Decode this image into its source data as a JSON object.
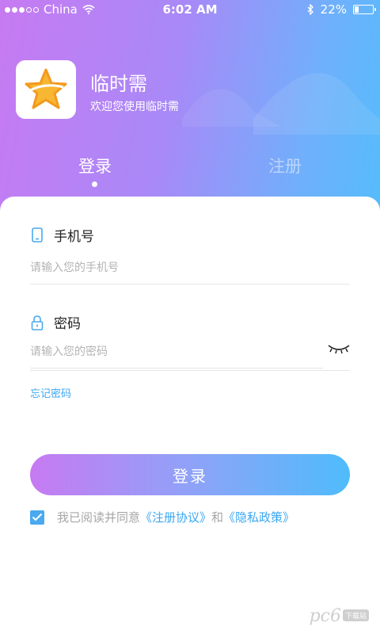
{
  "status_bar": {
    "carrier": "China",
    "time": "6:02 AM",
    "battery": "22%",
    "battery_level": 0.22
  },
  "app": {
    "name": "临时需",
    "welcome": "欢迎您使用临时需",
    "icon": "star-icon"
  },
  "tabs": [
    {
      "label": "登录",
      "active": true
    },
    {
      "label": "注册",
      "active": false
    }
  ],
  "phone": {
    "label": "手机号",
    "placeholder": "请输入您的手机号",
    "value": ""
  },
  "password": {
    "label": "密码",
    "placeholder": "请输入您的密码",
    "value": ""
  },
  "forgot_label": "忘记密码",
  "login_button": "登录",
  "agreement": {
    "checked": true,
    "prefix": "我已阅读并同意",
    "terms": "《注册协议》",
    "conj": "和",
    "privacy": "《隐私政策》"
  },
  "watermark": {
    "text": "pc6",
    "badge": "下载站"
  },
  "colors": {
    "accent": "#3aa7f3",
    "gradient_start": "#c77af2",
    "gradient_end": "#4fbcfb"
  }
}
